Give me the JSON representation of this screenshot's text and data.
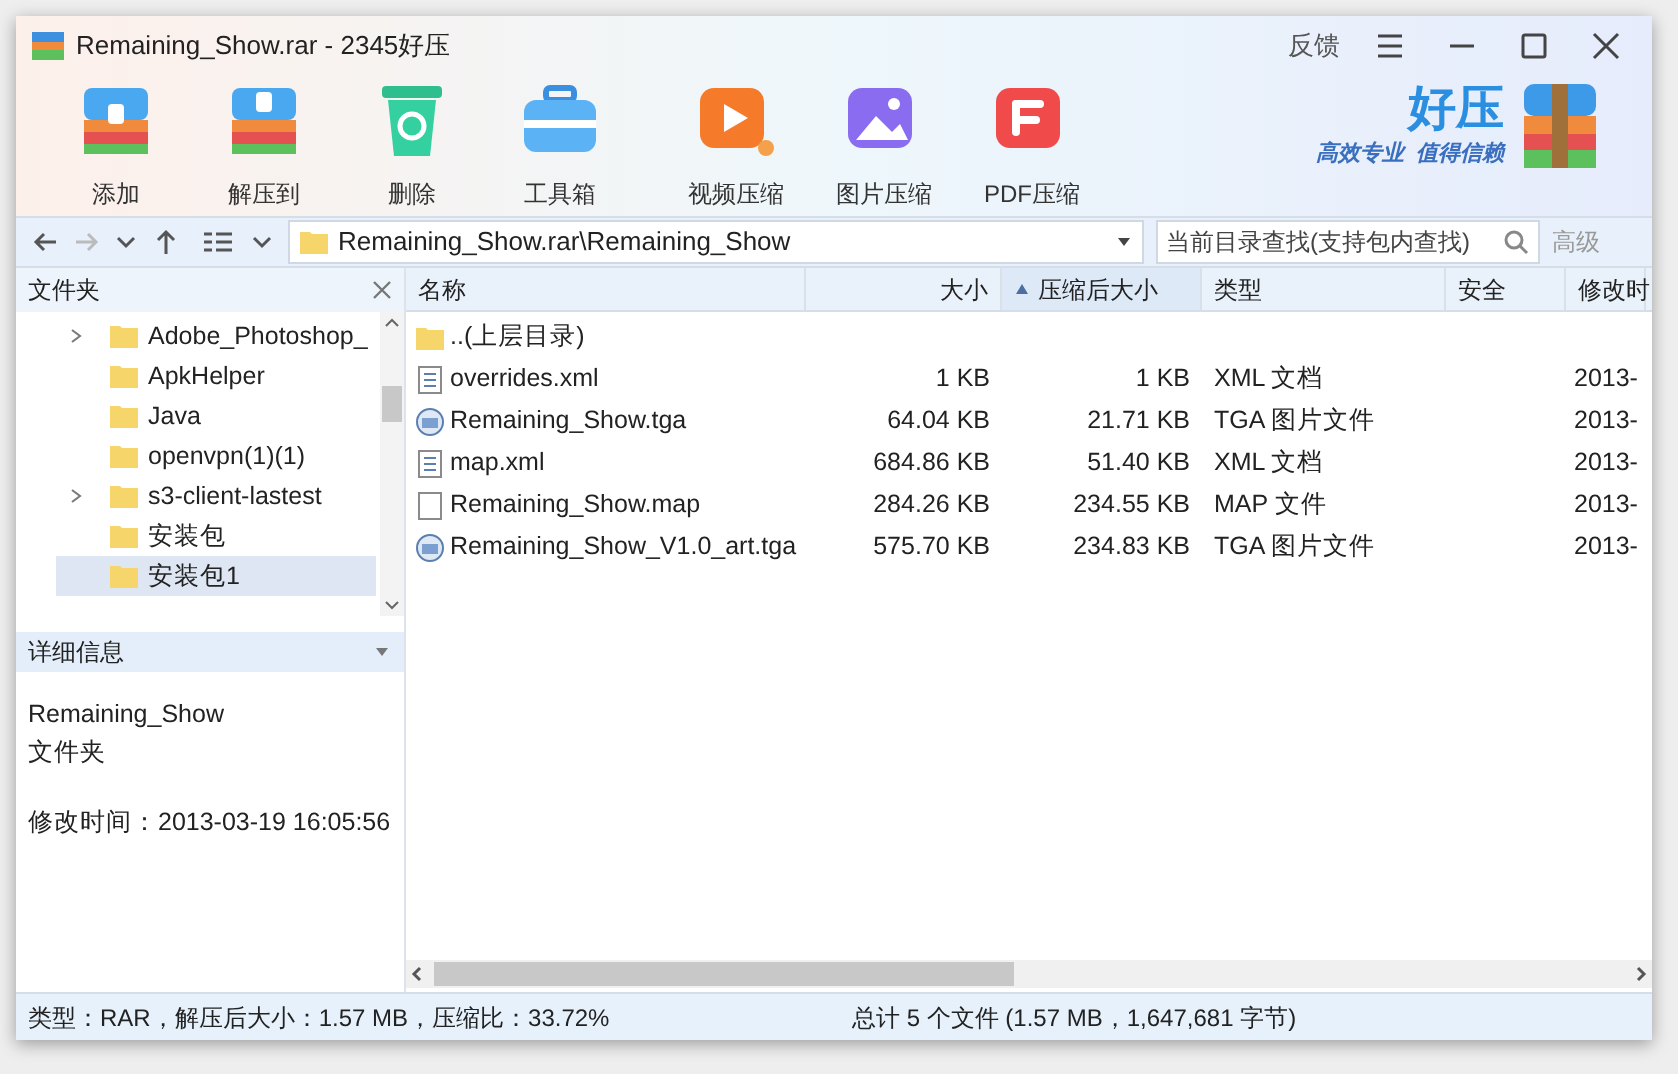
{
  "window": {
    "title": "Remaining_Show.rar - 2345好压",
    "feedback": "反馈"
  },
  "toolbar": {
    "groups": [
      [
        {
          "label": "添加",
          "kind": "add"
        },
        {
          "label": "解压到",
          "kind": "extract"
        },
        {
          "label": "删除",
          "kind": "delete"
        },
        {
          "label": "工具箱",
          "kind": "tools"
        }
      ],
      [
        {
          "label": "视频压缩",
          "kind": "video"
        },
        {
          "label": "图片压缩",
          "kind": "image"
        },
        {
          "label": "PDF压缩",
          "kind": "pdf"
        }
      ]
    ]
  },
  "logo": {
    "title": "好压",
    "slogan_1": "高效专业",
    "slogan_2": "值得信赖"
  },
  "address": {
    "path": "Remaining_Show.rar\\Remaining_Show",
    "search_placeholder": "当前目录查找(支持包内查找)",
    "advanced": "高级"
  },
  "folder_panel": {
    "title": "文件夹",
    "items": [
      {
        "name": "Adobe_Photoshop_",
        "has_children": true,
        "selected": false
      },
      {
        "name": "ApkHelper",
        "has_children": false,
        "selected": false
      },
      {
        "name": "Java",
        "has_children": false,
        "selected": false
      },
      {
        "name": "openvpn(1)(1)",
        "has_children": false,
        "selected": false
      },
      {
        "name": "s3-client-lastest",
        "has_children": true,
        "selected": false
      },
      {
        "name": "安装包",
        "has_children": false,
        "selected": false
      },
      {
        "name": "安装包1",
        "has_children": false,
        "selected": true
      }
    ]
  },
  "details": {
    "title": "详细信息",
    "name": "Remaining_Show",
    "type": "文件夹",
    "modified": "修改时间：2013-03-19 16:05:56"
  },
  "file_list": {
    "columns": [
      {
        "label": "名称",
        "sorted": false
      },
      {
        "label": "大小",
        "sorted": false
      },
      {
        "label": "压缩后大小",
        "sorted": true
      },
      {
        "label": "类型",
        "sorted": false
      },
      {
        "label": "安全",
        "sorted": false
      },
      {
        "label": "修改时",
        "sorted": false
      }
    ],
    "rows": [
      {
        "kind": "folder",
        "name": "..(上层目录)"
      },
      {
        "kind": "document",
        "name": "overrides.xml",
        "size": "1 KB",
        "packed": "1 KB",
        "type": "XML 文档",
        "modified": "2013-"
      },
      {
        "kind": "image",
        "name": "Remaining_Show.tga",
        "size": "64.04 KB",
        "packed": "21.71 KB",
        "type": "TGA 图片文件",
        "modified": "2013-"
      },
      {
        "kind": "document",
        "name": "map.xml",
        "size": "684.86 KB",
        "packed": "51.40 KB",
        "type": "XML 文档",
        "modified": "2013-"
      },
      {
        "kind": "blank",
        "name": "Remaining_Show.map",
        "size": "284.26 KB",
        "packed": "234.55 KB",
        "type": "MAP 文件",
        "modified": "2013-"
      },
      {
        "kind": "image",
        "name": "Remaining_Show_V1.0_art.tga",
        "size": "575.70 KB",
        "packed": "234.83 KB",
        "type": "TGA 图片文件",
        "modified": "2013-"
      }
    ]
  },
  "status_bar": {
    "left": "类型：RAR，解压后大小：1.57 MB，压缩比：33.72%",
    "right": "总计 5 个文件 (1.57 MB，1,647,681 字节)"
  }
}
